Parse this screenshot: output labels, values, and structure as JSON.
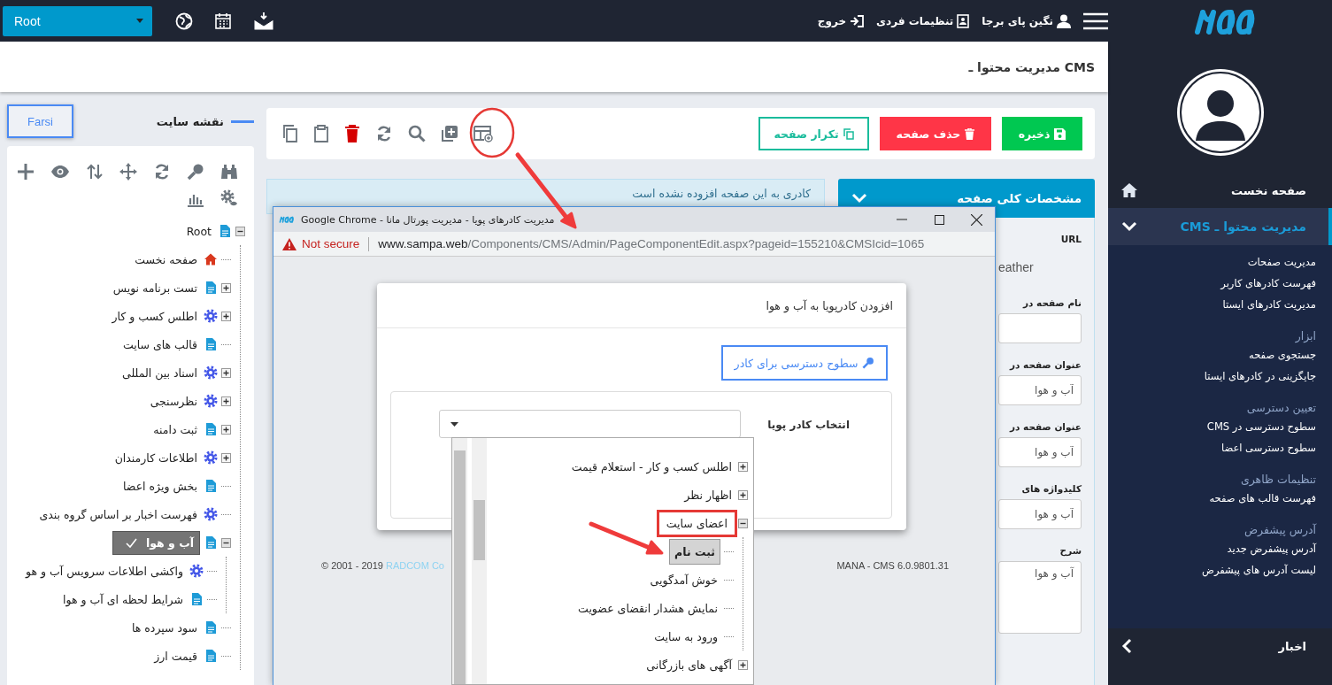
{
  "topbar": {
    "site_select": "Root",
    "user": "نگین پای برجا",
    "settings": "تنظیمات فردی",
    "logout": "خروج"
  },
  "page_title": "مدیریت محتوا ـ CMS",
  "sitemap": {
    "language_button": "Farsi",
    "title": "نقشه سایت",
    "tree": [
      {
        "label": "Root",
        "kind": "page",
        "expanded": true,
        "selected": false,
        "children": [
          {
            "label": "صفحه نخست",
            "kind": "home",
            "selected": false
          },
          {
            "label": "تست برنامه نویس",
            "kind": "page",
            "expanded": false,
            "selected": false
          },
          {
            "label": "اطلس کسب و کار",
            "kind": "gear",
            "expanded": false,
            "selected": false
          },
          {
            "label": "قالب های سایت",
            "kind": "page",
            "selected": false
          },
          {
            "label": "اسناد بین المللی",
            "kind": "gear",
            "expanded": false,
            "selected": false
          },
          {
            "label": "نظرسنجی",
            "kind": "gear",
            "expanded": false,
            "selected": false
          },
          {
            "label": "ثبت دامنه",
            "kind": "page",
            "expanded": false,
            "selected": false
          },
          {
            "label": "اطلاعات کارمندان",
            "kind": "gear",
            "expanded": false,
            "selected": false
          },
          {
            "label": "بخش ویژه اعضا",
            "kind": "page",
            "selected": false
          },
          {
            "label": "فهرست اخبار بر اساس گروه بندی",
            "kind": "gear",
            "selected": false
          },
          {
            "label": "آب و هوا",
            "kind": "page",
            "expanded": true,
            "selected": true,
            "children": [
              {
                "label": "واکشی اطلاعات سرویس آب و هو",
                "kind": "gear",
                "selected": false
              },
              {
                "label": "شرایط لحظه ای آب و هوا",
                "kind": "page",
                "selected": false
              }
            ]
          },
          {
            "label": "سود سپرده ها",
            "kind": "page",
            "selected": false
          },
          {
            "label": "قیمت ارز",
            "kind": "page",
            "selected": false
          }
        ]
      }
    ]
  },
  "toolbar": {
    "duplicate": "تکرار صفحه",
    "delete": "حذف صفحه",
    "save": "ذخیره"
  },
  "notice": "کادری به این صفحه افزوده نشده است",
  "properties": {
    "title": "مشخصات کلی صفحه",
    "fields": [
      {
        "label": "URL",
        "kind": "text",
        "value": "eather"
      },
      {
        "label": "نام صفحه در",
        "kind": "input"
      },
      {
        "label": "عنوان صفحه در",
        "kind": "input",
        "value": "آب و هوا"
      },
      {
        "label": "عنوان صفحه در",
        "kind": "input",
        "value": "آب و هوا"
      },
      {
        "label": "کلیدواژه های",
        "kind": "input",
        "value": "آب و هوا"
      },
      {
        "label": "شرح",
        "kind": "textarea",
        "value": "آب و هوا"
      }
    ]
  },
  "browser_popup": {
    "title": "مدیریت کادرهای پویا - مدیریت پورتال مانا - Google Chrome",
    "security": "Not secure",
    "url_host": "www.sampa.web",
    "url_path": "/Components/CMS/Admin/PageComponentEdit.aspx?pageid=155210&CMSIcid=1065",
    "dialog": {
      "title": "افزودن کادرپویا به آب و هوا",
      "access_button": "سطوح دسترسی برای کادر",
      "select_label": "انتخاب کادر پویا",
      "dropdown_tree": [
        {
          "label": "اطلس کسب و کار - استعلام قیمت",
          "expanded": false,
          "selected": false,
          "annotated": false
        },
        {
          "label": "اظهار نظر",
          "expanded": false,
          "selected": false,
          "annotated": false
        },
        {
          "label": "اعضای سایت",
          "expanded": true,
          "selected": false,
          "annotated": true,
          "children": [
            {
              "label": "ثبت نام",
              "selected": true,
              "annotated": false
            },
            {
              "label": "خوش آمدگویی",
              "selected": false,
              "annotated": false
            },
            {
              "label": "نمایش هشدار انقضای عضویت",
              "selected": false,
              "annotated": false
            },
            {
              "label": "ورود به سایت",
              "selected": false,
              "annotated": false
            }
          ]
        },
        {
          "label": "آگهی های بازرگانی",
          "expanded": false,
          "selected": false,
          "annotated": false
        }
      ]
    },
    "copyright": "© 2001 - 2019",
    "company": "RADCOM Co",
    "version": "MANA - CMS 6.0.9801.31"
  },
  "sidebar": {
    "menu": [
      {
        "label": "صفحه نخست",
        "kind": "home",
        "selected": false
      },
      {
        "label": "مدیریت محتوا ـ CMS",
        "kind": "section",
        "selected": true,
        "expanded": true,
        "groups": [
          {
            "items": [
              "مدیریت صفحات",
              "فهرست کادرهای کاربر",
              "مدیریت کادرهای ایستا"
            ]
          },
          {
            "heading": "ابزار",
            "items": [
              "جستجوی صفحه",
              "جایگزینی در کادرهای ایستا"
            ]
          },
          {
            "heading": "تعیین دسترسی",
            "items": [
              "سطوح دسترسی در CMS",
              "سطوح دسترسی اعضا"
            ]
          },
          {
            "heading": "تنظیمات ظاهری",
            "items": [
              "فهرست قالب های صفحه"
            ]
          },
          {
            "heading": "آدرس پیشفرض",
            "items": [
              "آدرس پیشفرض جدید",
              "لیست آدرس های پیشفرض"
            ]
          }
        ]
      },
      {
        "label": "اخبار",
        "kind": "section",
        "selected": false,
        "expanded": false
      }
    ]
  }
}
